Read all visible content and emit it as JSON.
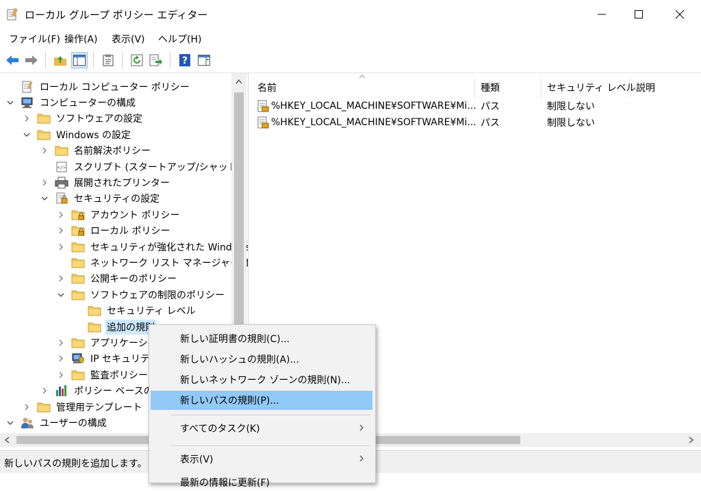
{
  "window": {
    "title": "ローカル グループ ポリシー エディター"
  },
  "menu": [
    "ファイル(F)",
    "操作(A)",
    "表示(V)",
    "ヘルプ(H)"
  ],
  "tree": [
    {
      "label": "ローカル コンピューター ポリシー",
      "icon": "computer-policy-icon",
      "level": 0,
      "exp": "none"
    },
    {
      "label": "コンピューターの構成",
      "icon": "computer-icon",
      "level": 0,
      "exp": "open"
    },
    {
      "label": "ソフトウェアの設定",
      "icon": "folder-icon",
      "level": 1,
      "exp": "closed"
    },
    {
      "label": "Windows の設定",
      "icon": "folder-icon",
      "level": 1,
      "exp": "open"
    },
    {
      "label": "名前解決ポリシー",
      "icon": "folder-icon",
      "level": 2,
      "exp": "closed"
    },
    {
      "label": "スクリプト (スタートアップ/シャットダウン)",
      "icon": "script-icon",
      "level": 2,
      "exp": "none"
    },
    {
      "label": "展開されたプリンター",
      "icon": "printer-icon",
      "level": 2,
      "exp": "closed"
    },
    {
      "label": "セキュリティの設定",
      "icon": "security-settings-icon",
      "level": 2,
      "exp": "open"
    },
    {
      "label": "アカウント ポリシー",
      "icon": "locked-folder-icon",
      "level": 3,
      "exp": "closed"
    },
    {
      "label": "ローカル ポリシー",
      "icon": "locked-folder-icon",
      "level": 3,
      "exp": "closed"
    },
    {
      "label": "セキュリティが強化された Windows",
      "icon": "folder-icon",
      "level": 3,
      "exp": "closed"
    },
    {
      "label": "ネットワーク リスト マネージャー ポリシー",
      "icon": "folder-icon",
      "level": 3,
      "exp": "none"
    },
    {
      "label": "公開キーのポリシー",
      "icon": "folder-icon",
      "level": 3,
      "exp": "closed"
    },
    {
      "label": "ソフトウェアの制限のポリシー",
      "icon": "folder-icon",
      "level": 3,
      "exp": "open"
    },
    {
      "label": "セキュリティ レベル",
      "icon": "folder-icon",
      "level": 4,
      "exp": "none"
    },
    {
      "label": "追加の規則",
      "icon": "folder-icon",
      "level": 4,
      "exp": "none",
      "selected": true
    },
    {
      "label": "アプリケーション",
      "icon": "folder-icon",
      "level": 3,
      "exp": "closed"
    },
    {
      "label": "IP セキュリティ",
      "icon": "ip-security-icon",
      "level": 3,
      "exp": "closed"
    },
    {
      "label": "監査ポリシーの",
      "icon": "folder-icon",
      "level": 3,
      "exp": "closed"
    },
    {
      "label": "ポリシー ベースの C",
      "icon": "chart-icon",
      "level": 2,
      "exp": "closed"
    },
    {
      "label": "管理用テンプレート",
      "icon": "folder-icon",
      "level": 1,
      "exp": "closed"
    },
    {
      "label": "ユーザーの構成",
      "icon": "users-icon",
      "level": 0,
      "exp": "open"
    }
  ],
  "columns": [
    "名前",
    "種類",
    "セキュリティ レベル",
    "説明"
  ],
  "rows": [
    {
      "name": "%HKEY_LOCAL_MACHINE¥SOFTWARE¥Mi...",
      "type": "パス",
      "level": "制限しない",
      "desc": ""
    },
    {
      "name": "%HKEY_LOCAL_MACHINE¥SOFTWARE¥Mi...",
      "type": "パス",
      "level": "制限しない",
      "desc": ""
    }
  ],
  "context_menu": [
    {
      "label": "新しい証明書の規則(C)...",
      "submenu": false
    },
    {
      "label": "新しいハッシュの規則(A)...",
      "submenu": false
    },
    {
      "label": "新しいネットワーク ゾーンの規則(N)...",
      "submenu": false
    },
    {
      "label": "新しいパスの規則(P)...",
      "submenu": false,
      "highlighted": true
    },
    {
      "separator": true
    },
    {
      "label": "すべてのタスク(K)",
      "submenu": true
    },
    {
      "separator": true
    },
    {
      "label": "表示(V)",
      "submenu": true
    },
    {
      "label": "最新の情報に更新(F)",
      "submenu": false
    }
  ],
  "status": "新しいパスの規則を追加します。",
  "colors": {
    "selection": "#cce8ff",
    "menu_highlight": "#91c9f7",
    "folder": "#f3c95c",
    "accent_blue": "#2b7fd8"
  }
}
